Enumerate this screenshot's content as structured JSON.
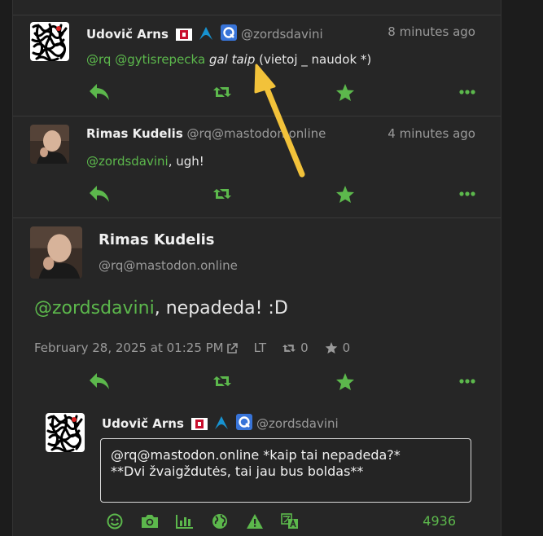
{
  "colors": {
    "accent": "#5cb84c",
    "arrow": "#f2c23a",
    "background": "#262626"
  },
  "statuses": [
    {
      "display_name": "Udovič Arns",
      "acct": "@zordsdavini",
      "time": "8 minutes ago",
      "content": {
        "mention1": "@rq",
        "mention2": "@gytisrepecka",
        "italic": "gal taip",
        "rest": "(vietoj _ naudok *)"
      },
      "avatar_icon": "lace-pattern-avatar",
      "badges": [
        "flag-icon",
        "arch-icon",
        "qubes-icon"
      ]
    },
    {
      "display_name": "Rimas Kudelis",
      "acct": "@rq@mastodon.online",
      "time": "4 minutes ago",
      "content": {
        "mention": "@zordsdavini",
        "rest": ", ugh!"
      },
      "avatar_icon": "person-photo-avatar"
    }
  ],
  "detailed": {
    "display_name": "Rimas Kudelis",
    "acct": "@rq@mastodon.online",
    "mention": "@zordsdavini",
    "text": ", nepadeda! :D",
    "date": "February 28, 2025 at 01:25 PM",
    "language": "LT",
    "reblogs": "0",
    "favourites": "0"
  },
  "compose": {
    "display_name": "Udovič Arns",
    "acct": "@zordsdavini",
    "text": "@rq@mastodon.online *kaip tai nepadeda?*\n**Dvi žvaigždutės, tai jau bus boldas**",
    "char_counter": "4936",
    "tools": [
      "emoji-icon",
      "camera-icon",
      "poll-icon",
      "globe-icon",
      "warning-icon",
      "translate-icon"
    ]
  }
}
